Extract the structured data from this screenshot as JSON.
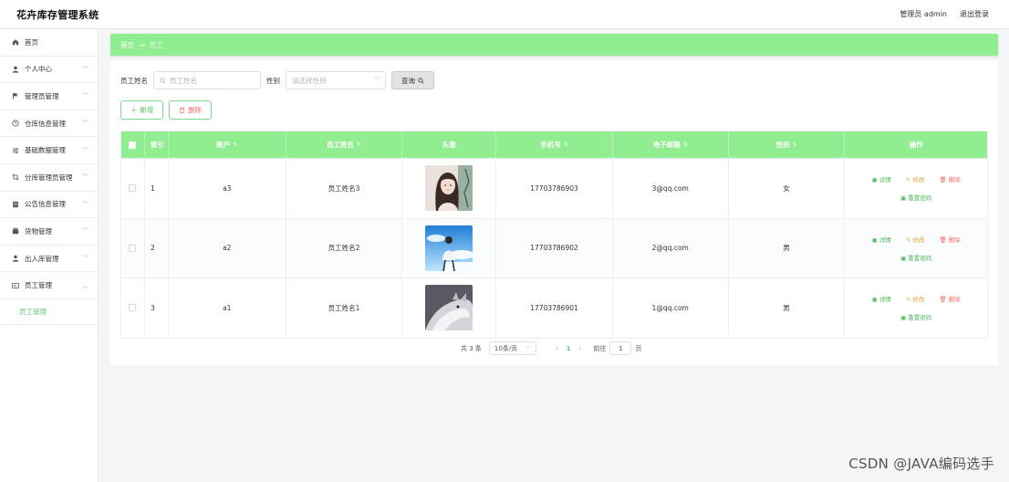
{
  "header": {
    "title": "花卉库存管理系统",
    "user": "管理员 admin",
    "logout": "退出登录"
  },
  "sidebar": {
    "items": [
      {
        "label": "首页",
        "icon": "home-icon",
        "has_children": false
      },
      {
        "label": "个人中心",
        "icon": "user-icon",
        "has_children": true
      },
      {
        "label": "管理员管理",
        "icon": "flag-icon",
        "has_children": true
      },
      {
        "label": "仓库信息管理",
        "icon": "clock-icon",
        "has_children": true
      },
      {
        "label": "基础数据管理",
        "icon": "sliders-icon",
        "has_children": true
      },
      {
        "label": "分库管理员管理",
        "icon": "crop-icon",
        "has_children": true
      },
      {
        "label": "公告信息管理",
        "icon": "document-icon",
        "has_children": true
      },
      {
        "label": "货物管理",
        "icon": "box-icon",
        "has_children": true
      },
      {
        "label": "出入库管理",
        "icon": "user-icon",
        "has_children": true
      },
      {
        "label": "员工管理",
        "icon": "id-card-icon",
        "has_children": true,
        "expanded": true
      }
    ],
    "sub_item": "员工管理"
  },
  "breadcrumb": {
    "home": "首页",
    "current": "员工"
  },
  "filters": {
    "name_label": "员工姓名",
    "name_placeholder": "员工姓名",
    "sex_label": "性别",
    "sex_placeholder": "请选择性别",
    "query_button": "查询"
  },
  "actions": {
    "add": "新增",
    "delete": "删除"
  },
  "table": {
    "columns": [
      "索引",
      "账户",
      "员工姓名",
      "头像",
      "手机号",
      "电子邮箱",
      "性别",
      "操作"
    ],
    "rows": [
      {
        "index": "1",
        "account": "a3",
        "name": "员工姓名3",
        "phone": "17703786903",
        "email": "3@qq.com",
        "sex": "女"
      },
      {
        "index": "2",
        "account": "a2",
        "name": "员工姓名2",
        "phone": "17703786902",
        "email": "2@qq.com",
        "sex": "男"
      },
      {
        "index": "3",
        "account": "a1",
        "name": "员工姓名1",
        "phone": "17703786901",
        "email": "1@qq.com",
        "sex": "男"
      }
    ],
    "ops": {
      "detail": "详情",
      "edit": "修改",
      "delete": "删除",
      "reset": "重置密码"
    }
  },
  "pagination": {
    "total": "共 3 条",
    "page_size": "10条/页",
    "current": "1",
    "goto_label": "前往",
    "goto_value": "1",
    "page_unit": "页"
  },
  "watermark": "CSDN @JAVA编码选手",
  "colors": {
    "accent": "#90ee90",
    "link_green": "#52b85f",
    "warning": "#e6a23c",
    "danger": "#f56c6c"
  }
}
